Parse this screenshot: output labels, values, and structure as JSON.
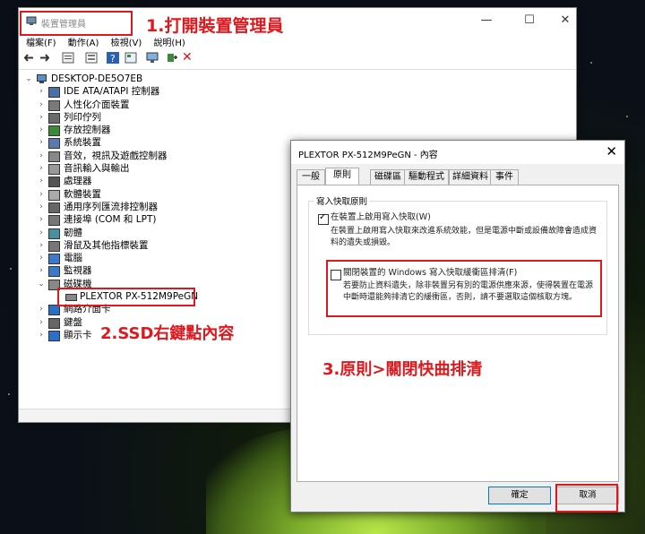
{
  "colors": {
    "annotation_red": "#e0181e"
  },
  "device_manager": {
    "title": "裝置管理員",
    "menu": [
      "檔案(F)",
      "動作(A)",
      "檢視(V)",
      "說明(H)"
    ],
    "toolbar_icons": [
      "back-icon",
      "forward-icon",
      "properties-icon",
      "list-icon",
      "help-icon",
      "view-icon",
      "monitor-icon",
      "update-driver-icon",
      "uninstall-icon"
    ],
    "tree": {
      "root": "DESKTOP-DE5O7EB",
      "categories": [
        "IDE ATA/ATAPI 控制器",
        "人性化介面裝置",
        "列印佇列",
        "存放控制器",
        "系統裝置",
        "音效，視訊及遊戲控制器",
        "音訊輸入與輸出",
        "處理器",
        "軟體裝置",
        "通用序列匯流排控制器",
        "連接埠 (COM 和 LPT)",
        "韌體",
        "滑鼠及其他指標裝置",
        "電腦",
        "監視器",
        "磁碟機",
        "網路介面卡",
        "鍵盤",
        "顯示卡"
      ],
      "disk_child": "PLEXTOR PX-512M9PeGN"
    }
  },
  "annotations": {
    "step1": "1.打開裝置管理員",
    "step2": "2.SSD右鍵點內容",
    "step3": "3.原則>關閉快曲排清"
  },
  "properties": {
    "title": "PLEXTOR PX-512M9PeGN - 內容",
    "tabs": [
      "一般",
      "原則",
      "磁碟區",
      "驅動程式",
      "詳細資料",
      "事件"
    ],
    "active_tab": "原則",
    "group_title": "寫入快取原則",
    "option1": {
      "label": "在裝置上啟用寫入快取(W)",
      "checked": true,
      "desc": "在裝置上啟用寫入快取來改進系統效能，但是電源中斷或設備故障會造成資料的遺失或損毀。"
    },
    "option2": {
      "label": "關閉裝置的 Windows 寫入快取緩衝區排清(F)",
      "checked": false,
      "desc": "若要防止資料遺失，除非裝置另有別的電源供應來源，使得裝置在電源中斷時還能夠排清它的緩衝區，否則，請不要選取這個核取方塊。"
    },
    "ok": "確定",
    "cancel": "取消"
  }
}
